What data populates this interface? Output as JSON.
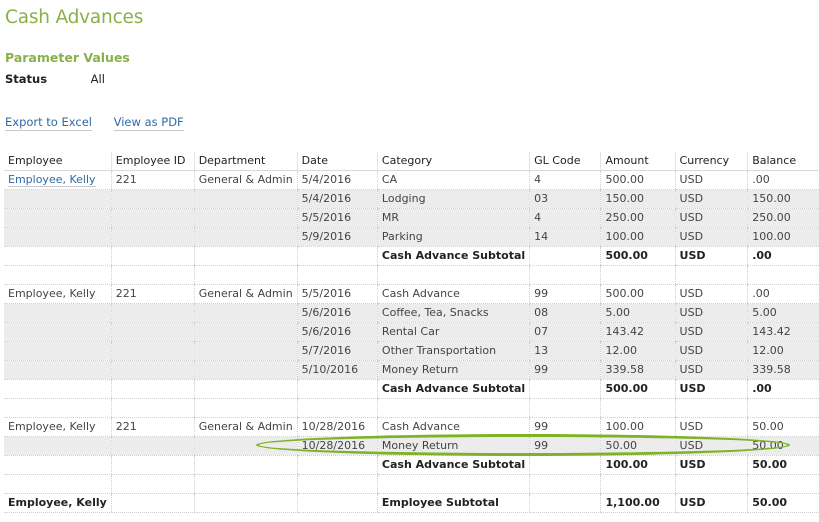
{
  "page": {
    "title": "Cash Advances",
    "title_color": "#8ab04a"
  },
  "parameters": {
    "heading": "Parameter Values",
    "items": [
      {
        "label": "Status",
        "value": "All"
      }
    ]
  },
  "actions": {
    "export_excel": "Export to Excel",
    "view_pdf": "View as PDF"
  },
  "table": {
    "columns": [
      "Employee",
      "Employee ID",
      "Department",
      "Date",
      "Category",
      "GL Code",
      "Amount",
      "Currency",
      "Balance"
    ],
    "rows": [
      {
        "type": "detail",
        "shaded": false,
        "employee": "Employee, Kelly",
        "employee_link": true,
        "employee_id": "221",
        "department": "General & Admin",
        "date": "5/4/2016",
        "category": "CA",
        "gl_code": "4",
        "amount": "500.00",
        "currency": "USD",
        "balance": ".00"
      },
      {
        "type": "detail",
        "shaded": true,
        "employee": "",
        "employee_id": "",
        "department": "",
        "date": "5/4/2016",
        "category": "Lodging",
        "gl_code": "03",
        "amount": "150.00",
        "currency": "USD",
        "balance": "150.00"
      },
      {
        "type": "detail",
        "shaded": true,
        "employee": "",
        "employee_id": "",
        "department": "",
        "date": "5/5/2016",
        "category": "MR",
        "gl_code": "4",
        "amount": "250.00",
        "currency": "USD",
        "balance": "250.00"
      },
      {
        "type": "detail",
        "shaded": true,
        "employee": "",
        "employee_id": "",
        "department": "",
        "date": "5/9/2016",
        "category": "Parking",
        "gl_code": "14",
        "amount": "100.00",
        "currency": "USD",
        "balance": "100.00"
      },
      {
        "type": "subtotal",
        "category": "Cash Advance Subtotal",
        "amount": "500.00",
        "currency": "USD",
        "balance": ".00"
      },
      {
        "type": "spacer"
      },
      {
        "type": "detail",
        "shaded": false,
        "employee": "Employee, Kelly",
        "employee_link": false,
        "employee_id": "221",
        "department": "General & Admin",
        "date": "5/5/2016",
        "category": "Cash Advance",
        "gl_code": "99",
        "amount": "500.00",
        "currency": "USD",
        "balance": ".00"
      },
      {
        "type": "detail",
        "shaded": true,
        "employee": "",
        "employee_id": "",
        "department": "",
        "date": "5/6/2016",
        "category": "Coffee, Tea, Snacks",
        "gl_code": "08",
        "amount": "5.00",
        "currency": "USD",
        "balance": "5.00"
      },
      {
        "type": "detail",
        "shaded": true,
        "employee": "",
        "employee_id": "",
        "department": "",
        "date": "5/6/2016",
        "category": "Rental Car",
        "gl_code": "07",
        "amount": "143.42",
        "currency": "USD",
        "balance": "143.42"
      },
      {
        "type": "detail",
        "shaded": true,
        "employee": "",
        "employee_id": "",
        "department": "",
        "date": "5/7/2016",
        "category": "Other Transportation",
        "gl_code": "13",
        "amount": "12.00",
        "currency": "USD",
        "balance": "12.00"
      },
      {
        "type": "detail",
        "shaded": true,
        "employee": "",
        "employee_id": "",
        "department": "",
        "date": "5/10/2016",
        "category": "Money Return",
        "gl_code": "99",
        "amount": "339.58",
        "currency": "USD",
        "balance": "339.58"
      },
      {
        "type": "subtotal",
        "category": "Cash Advance Subtotal",
        "amount": "500.00",
        "currency": "USD",
        "balance": ".00"
      },
      {
        "type": "spacer"
      },
      {
        "type": "detail",
        "shaded": false,
        "employee": "Employee, Kelly",
        "employee_link": false,
        "employee_id": "221",
        "department": "General & Admin",
        "date": "10/28/2016",
        "category": "Cash Advance",
        "gl_code": "99",
        "amount": "100.00",
        "currency": "USD",
        "balance": "50.00"
      },
      {
        "type": "detail",
        "shaded": true,
        "highlighted": true,
        "employee": "",
        "employee_id": "",
        "department": "",
        "date": "10/28/2016",
        "category": "Money Return",
        "gl_code": "99",
        "amount": "50.00",
        "currency": "USD",
        "balance": "50.00"
      },
      {
        "type": "subtotal",
        "category": "Cash Advance Subtotal",
        "amount": "100.00",
        "currency": "USD",
        "balance": "50.00"
      },
      {
        "type": "spacer"
      },
      {
        "type": "employee_subtotal",
        "employee": "Employee, Kelly",
        "category": "Employee Subtotal",
        "amount": "1,100.00",
        "currency": "USD",
        "balance": "50.00"
      }
    ]
  },
  "highlight": {
    "color": "#7fb227",
    "target": "10/28/2016 Money Return row"
  }
}
